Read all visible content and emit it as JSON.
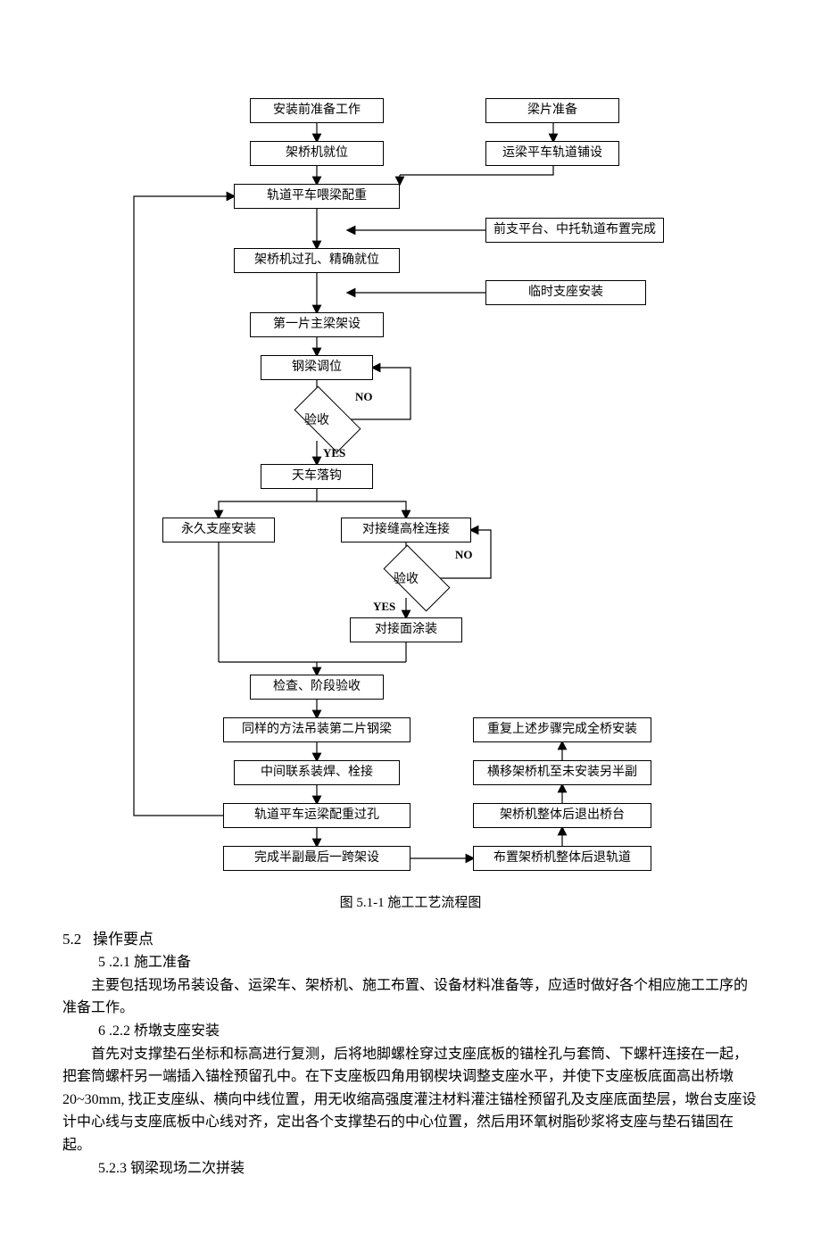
{
  "chart_data": {
    "type": "flowchart",
    "title": "图 5.1-1 施工工艺流程图",
    "nodes": [
      {
        "id": "n_prep",
        "label": "安装前准备工作",
        "type": "process"
      },
      {
        "id": "n_beamprep",
        "label": "梁片准备",
        "type": "process"
      },
      {
        "id": "n_launcher",
        "label": "架桥机就位",
        "type": "process"
      },
      {
        "id": "n_rail",
        "label": "运梁平车轨道铺设",
        "type": "process"
      },
      {
        "id": "n_trackBalance",
        "label": "轨道平车喂梁配重",
        "type": "process"
      },
      {
        "id": "n_frontPlatform",
        "label": "前支平台、中托轨道布置完成",
        "type": "process"
      },
      {
        "id": "n_throughHole",
        "label": "架桥机过孔、精确就位",
        "type": "process"
      },
      {
        "id": "n_tempBearing",
        "label": "临时支座安装",
        "type": "process"
      },
      {
        "id": "n_firstGirder",
        "label": "第一片主梁架设",
        "type": "process"
      },
      {
        "id": "n_adjust",
        "label": "钢梁调位",
        "type": "process"
      },
      {
        "id": "d_accept1",
        "label": "验收",
        "type": "decision"
      },
      {
        "id": "n_dropHook",
        "label": "天车落钩",
        "type": "process"
      },
      {
        "id": "n_permBearing",
        "label": "永久支座安装",
        "type": "process"
      },
      {
        "id": "n_bolt",
        "label": "对接缝高栓连接",
        "type": "process"
      },
      {
        "id": "d_accept2",
        "label": "验收",
        "type": "decision"
      },
      {
        "id": "n_paint",
        "label": "对接面涂装",
        "type": "process"
      },
      {
        "id": "n_checkPhase",
        "label": "检查、阶段验收",
        "type": "process"
      },
      {
        "id": "n_secondGirder",
        "label": "同样的方法吊装第二片钢梁",
        "type": "process"
      },
      {
        "id": "n_midLink",
        "label": "中间联系装焊、栓接",
        "type": "process"
      },
      {
        "id": "n_trackThrough",
        "label": "轨道平车运梁配重过孔",
        "type": "process"
      },
      {
        "id": "n_halfFinal",
        "label": "完成半副最后一跨架设",
        "type": "process"
      },
      {
        "id": "n_retreatTrack",
        "label": "布置架桥机整体后退轨道",
        "type": "process"
      },
      {
        "id": "n_retreat",
        "label": "架桥机整体后退出桥台",
        "type": "process"
      },
      {
        "id": "n_shift",
        "label": "横移架桥机至未安装另半副",
        "type": "process"
      },
      {
        "id": "n_repeat",
        "label": "重复上述步骤完成全桥安装",
        "type": "process"
      }
    ],
    "edges": [
      {
        "from": "n_prep",
        "to": "n_launcher"
      },
      {
        "from": "n_beamprep",
        "to": "n_rail"
      },
      {
        "from": "n_launcher",
        "to": "n_trackBalance"
      },
      {
        "from": "n_rail",
        "to": "n_trackBalance"
      },
      {
        "from": "n_trackBalance",
        "to": "n_throughHole"
      },
      {
        "from": "n_frontPlatform",
        "to": "n_throughHole",
        "via": "between(trackBalance,throughHole)"
      },
      {
        "from": "n_throughHole",
        "to": "n_firstGirder"
      },
      {
        "from": "n_tempBearing",
        "to": "n_firstGirder",
        "via": "between(throughHole,firstGirder)"
      },
      {
        "from": "n_firstGirder",
        "to": "n_adjust"
      },
      {
        "from": "n_adjust",
        "to": "d_accept1"
      },
      {
        "from": "d_accept1",
        "to": "n_adjust",
        "label": "NO"
      },
      {
        "from": "d_accept1",
        "to": "n_dropHook",
        "label": "YES"
      },
      {
        "from": "n_dropHook",
        "to": "n_permBearing"
      },
      {
        "from": "n_dropHook",
        "to": "n_bolt"
      },
      {
        "from": "n_bolt",
        "to": "d_accept2"
      },
      {
        "from": "d_accept2",
        "to": "n_bolt",
        "label": "NO"
      },
      {
        "from": "d_accept2",
        "to": "n_paint",
        "label": "YES"
      },
      {
        "from": "n_permBearing",
        "to": "n_checkPhase"
      },
      {
        "from": "n_paint",
        "to": "n_checkPhase"
      },
      {
        "from": "n_checkPhase",
        "to": "n_secondGirder"
      },
      {
        "from": "n_secondGirder",
        "to": "n_midLink"
      },
      {
        "from": "n_midLink",
        "to": "n_trackThrough"
      },
      {
        "from": "n_trackThrough",
        "to": "n_trackBalance",
        "label": "loop-back"
      },
      {
        "from": "n_trackThrough",
        "to": "n_halfFinal"
      },
      {
        "from": "n_halfFinal",
        "to": "n_retreatTrack"
      },
      {
        "from": "n_retreatTrack",
        "to": "n_retreat"
      },
      {
        "from": "n_retreat",
        "to": "n_shift"
      },
      {
        "from": "n_shift",
        "to": "n_repeat"
      }
    ],
    "edge_labels": {
      "yes": "YES",
      "no": "NO"
    }
  },
  "nodes": {
    "prep": "安装前准备工作",
    "beamprep": "梁片准备",
    "launcher": "架桥机就位",
    "rail": "运梁平车轨道铺设",
    "trackBalance": "轨道平车喂梁配重",
    "frontPlatform": "前支平台、中托轨道布置完成",
    "throughHole": "架桥机过孔、精确就位",
    "tempBearing": "临时支座安装",
    "firstGirder": "第一片主梁架设",
    "adjust": "钢梁调位",
    "accept1": "验收",
    "dropHook": "天车落钩",
    "permBearing": "永久支座安装",
    "bolt": "对接缝高栓连接",
    "accept2": "验收",
    "paint": "对接面涂装",
    "checkPhase": "检查、阶段验收",
    "secondGirder": "同样的方法吊装第二片钢梁",
    "midLink": "中间联系装焊、栓接",
    "trackThrough": "轨道平车运梁配重过孔",
    "halfFinal": "完成半副最后一跨架设",
    "retreatTrack": "布置架桥机整体后退轨道",
    "retreat": "架桥机整体后退出桥台",
    "shift": "横移架桥机至未安装另半副",
    "repeat": "重复上述步骤完成全桥安装"
  },
  "labels": {
    "yes": "YES",
    "no": "NO"
  },
  "caption": "图 5.1-1 施工工艺流程图",
  "section": {
    "num": "5.2",
    "title": "操作要点",
    "s521num": "5 .2.1 施工准备",
    "s521body": "主要包括现场吊装设备、运梁车、架桥机、施工布置、设备材料准备等，应适时做好各个相应施工工序的准备工作。",
    "s522num": "6 .2.2 桥墩支座安装",
    "s522body": "首先对支撑垫石坐标和标高进行复测，后将地脚螺栓穿过支座底板的锚栓孔与套筒、下螺杆连接在一起，把套筒螺杆另一端插入锚栓预留孔中。在下支座板四角用钢楔块调整支座水平，并使下支座板底面高出桥墩 20~30mm, 找正支座纵、横向中线位置，用无收缩高强度灌注材料灌注锚栓预留孔及支座底面垫层，墩台支座设计中心线与支座底板中心线对齐，定出各个支撑垫石的中心位置，然后用环氧树脂砂浆将支座与垫石锚固在起。",
    "s523num": "5.2.3 钢梁现场二次拼装"
  }
}
